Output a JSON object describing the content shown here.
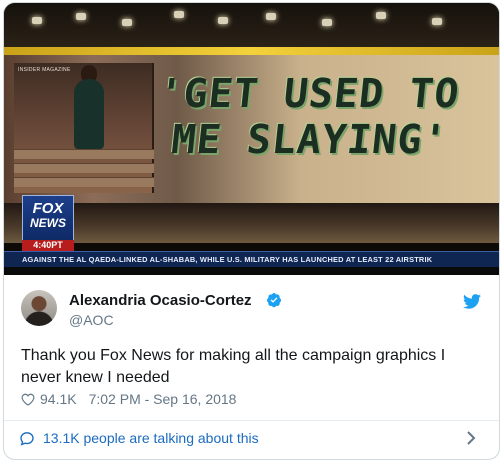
{
  "media": {
    "headline_line1": "'GET USED TO",
    "headline_line2": "ME SLAYING'",
    "photo_credit": "INSIDER MAGAZINE",
    "network_logo_top": "FOX",
    "network_logo_bottom": "NEWS",
    "broadcast_time": "4:40PT",
    "ticker_text": "AGAINST THE AL QAEDA-LINKED AL-SHABAB, WHILE U.S. MILITARY HAS LAUNCHED AT LEAST 22 AIRSTRIK"
  },
  "author": {
    "name": "Alexandria Ocasio-Cortez",
    "handle": "@AOC",
    "verified": true
  },
  "tweet": {
    "text": "Thank you Fox News for making all the campaign graphics I never knew I needed",
    "likes": "94.1K",
    "timestamp": "7:02 PM - Sep 16, 2018"
  },
  "footer": {
    "talking_text": "13.1K people are talking about this"
  },
  "colors": {
    "link_blue": "#1b6bc0",
    "twitter_blue": "#1da1f2",
    "muted_gray": "#657786",
    "text_dark": "#14171a"
  },
  "icons": [
    "verified-badge-icon",
    "twitter-bird-icon",
    "heart-icon",
    "speech-bubble-icon",
    "chevron-right-icon"
  ]
}
